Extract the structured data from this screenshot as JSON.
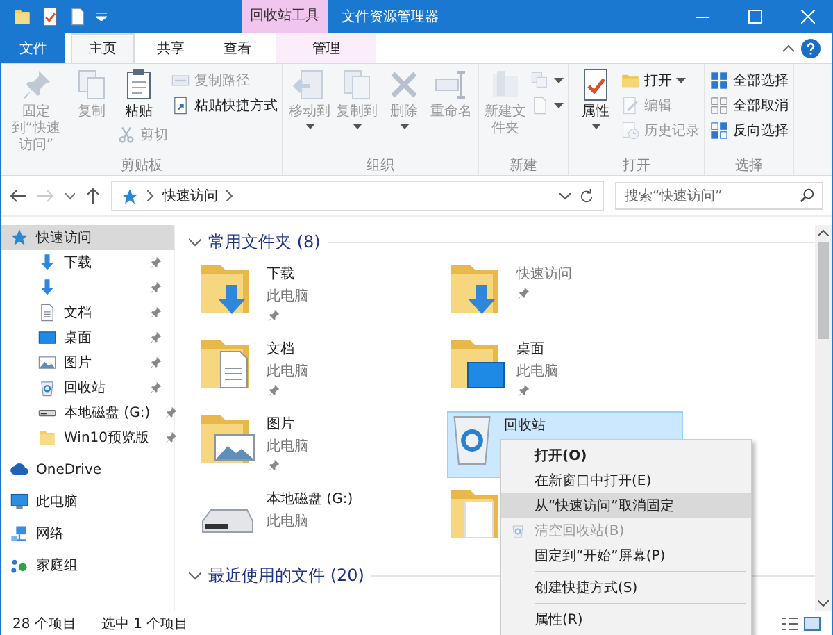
{
  "window": {
    "title": "文件资源管理器",
    "context_tab_header": "回收站工具"
  },
  "tabs": [
    {
      "label": "文件",
      "kind": "file",
      "selected": false
    },
    {
      "label": "主页",
      "kind": "normal",
      "selected": true
    },
    {
      "label": "共享",
      "kind": "normal",
      "selected": false
    },
    {
      "label": "查看",
      "kind": "normal",
      "selected": false
    },
    {
      "label": "管理",
      "kind": "context",
      "selected": false
    }
  ],
  "ribbon": {
    "groups": [
      {
        "label": "剪贴板",
        "columns": [
          [
            {
              "kind": "large",
              "label": "固定到“快速访问”",
              "disabled": true
            }
          ],
          [
            {
              "kind": "large",
              "label": "复制",
              "disabled": true
            }
          ],
          [
            {
              "kind": "large",
              "label": "粘贴",
              "disabled": false
            },
            {
              "kind": "small",
              "label": "剪切",
              "disabled": true
            }
          ],
          [
            {
              "kind": "small",
              "label": "复制路径",
              "disabled": true
            },
            {
              "kind": "small",
              "label": "粘贴快捷方式",
              "disabled": false
            }
          ]
        ]
      },
      {
        "label": "组织",
        "columns": [
          [
            {
              "kind": "large",
              "label": "移动到",
              "disabled": true,
              "dropdown": true
            }
          ],
          [
            {
              "kind": "large",
              "label": "复制到",
              "disabled": true,
              "dropdown": true
            }
          ],
          [
            {
              "kind": "large",
              "label": "删除",
              "disabled": true,
              "dropdown": true
            }
          ],
          [
            {
              "kind": "large",
              "label": "重命名",
              "disabled": true
            }
          ]
        ]
      },
      {
        "label": "新建",
        "columns": [
          [
            {
              "kind": "large",
              "label": "新建文件夹",
              "disabled": true
            }
          ],
          [
            {
              "kind": "small",
              "disabled": true,
              "dropdown": true
            },
            {
              "kind": "small",
              "disabled": true,
              "dropdown": true
            }
          ]
        ]
      },
      {
        "label": "打开",
        "columns": [
          [
            {
              "kind": "large",
              "label": "属性",
              "disabled": false,
              "dropdown": true
            }
          ],
          [
            {
              "kind": "small",
              "label": "打开",
              "disabled": false,
              "dropdown": true
            },
            {
              "kind": "small",
              "label": "编辑",
              "disabled": true
            },
            {
              "kind": "small",
              "label": "历史记录",
              "disabled": true
            }
          ]
        ]
      },
      {
        "label": "选择",
        "columns": [
          [
            {
              "kind": "small",
              "label": "全部选择",
              "disabled": false
            },
            {
              "kind": "small",
              "label": "全部取消",
              "disabled": false
            },
            {
              "kind": "small",
              "label": "反向选择",
              "disabled": false
            }
          ]
        ]
      }
    ]
  },
  "address": {
    "path": [
      "快速访问"
    ],
    "search": {
      "placeholder": "搜索“快速访问”"
    }
  },
  "sidebar": {
    "items": [
      {
        "label": "快速访问",
        "selected": true,
        "children": [
          {
            "label": "下载",
            "pinned": true,
            "selected": false
          },
          {
            "pinned": true,
            "selected": false
          },
          {
            "label": "文档",
            "pinned": true,
            "selected": false
          },
          {
            "label": "桌面",
            "pinned": true,
            "selected": false
          },
          {
            "label": "图片",
            "pinned": true,
            "selected": false
          },
          {
            "label": "回收站",
            "pinned": true,
            "selected": false
          },
          {
            "label": "本地磁盘 (G:)",
            "pinned": true,
            "selected": false
          },
          {
            "label": "Win10预览版",
            "pinned": true,
            "selected": false
          }
        ]
      },
      {
        "label": "OneDrive",
        "selected": false
      },
      {
        "label": "此电脑",
        "selected": false
      },
      {
        "label": "网络",
        "selected": false
      },
      {
        "label": "家庭组",
        "selected": false
      }
    ]
  },
  "content": {
    "groups": [
      {
        "title": "常用文件夹 (8)",
        "expanded": true,
        "items": [
          {
            "name": "下载",
            "subtitle": "此电脑",
            "pinned": true,
            "selected": false
          },
          {
            "subtitle": "快速访问",
            "pinned": true,
            "selected": false
          },
          {
            "name": "文档",
            "subtitle": "此电脑",
            "pinned": true,
            "selected": false
          },
          {
            "name": "桌面",
            "subtitle": "此电脑",
            "pinned": true,
            "selected": false
          },
          {
            "name": "图片",
            "subtitle": "此电脑",
            "pinned": true,
            "selected": false
          },
          {
            "name": "回收站",
            "pinned": false,
            "selected": true
          },
          {
            "name": "本地磁盘 (G:)",
            "subtitle": "此电脑",
            "pinned": false,
            "selected": false
          },
          {
            "pinned": false,
            "selected": false
          }
        ]
      },
      {
        "title": "最近使用的文件 (20)",
        "expanded": true
      }
    ]
  },
  "context_menu": {
    "items": [
      {
        "kind": "item",
        "label": "打开(O)",
        "default": true,
        "selected": false,
        "disabled": false
      },
      {
        "kind": "item",
        "label": "在新窗口中打开(E)",
        "default": false,
        "selected": false,
        "disabled": false
      },
      {
        "kind": "item",
        "label": "从“快速访问”取消固定",
        "default": false,
        "selected": true,
        "disabled": false
      },
      {
        "kind": "item",
        "label": "清空回收站(B)",
        "default": false,
        "selected": false,
        "disabled": true
      },
      {
        "kind": "item",
        "label": "固定到“开始”屏幕(P)",
        "default": false,
        "selected": false,
        "disabled": false
      },
      {
        "kind": "separator"
      },
      {
        "kind": "item",
        "label": "创建快捷方式(S)",
        "default": false,
        "selected": false,
        "disabled": false
      },
      {
        "kind": "separator"
      },
      {
        "kind": "item",
        "label": "属性(R)",
        "default": false,
        "selected": false,
        "disabled": false
      }
    ]
  },
  "status_bar": {
    "item_count": "28 个项目",
    "selection": "选中 1 个项目"
  }
}
